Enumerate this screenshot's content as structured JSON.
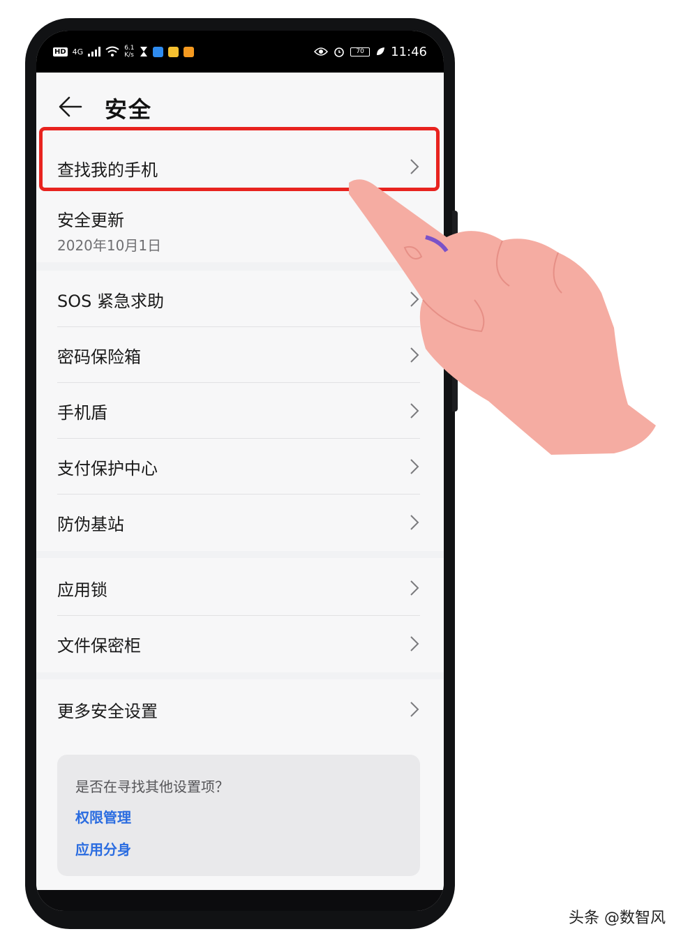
{
  "status_bar": {
    "hd": "HD",
    "network": "4G",
    "speed_value": "6.1",
    "speed_unit": "K/s",
    "battery": "70",
    "time": "11:46",
    "icons": [
      "signal-icon",
      "wifi-icon",
      "hourglass-icon",
      "app-notification-icon",
      "eye-icon",
      "alarm-icon",
      "battery-icon",
      "leaf-icon"
    ]
  },
  "header": {
    "title": "安全",
    "back_icon": "arrow-left-icon"
  },
  "groups": [
    {
      "items": [
        {
          "label": "查找我的手机",
          "highlighted": true
        },
        {
          "label": "安全更新",
          "sub": "2020年10月1日"
        }
      ]
    },
    {
      "items": [
        {
          "label": "SOS 紧急求助"
        },
        {
          "label": "密码保险箱"
        },
        {
          "label": "手机盾"
        },
        {
          "label": "支付保护中心"
        },
        {
          "label": "防伪基站"
        }
      ]
    },
    {
      "items": [
        {
          "label": "应用锁"
        },
        {
          "label": "文件保密柜"
        }
      ]
    },
    {
      "items": [
        {
          "label": "更多安全设置"
        }
      ]
    }
  ],
  "tip": {
    "question": "是否在寻找其他设置项？",
    "links": [
      "权限管理",
      "应用分身"
    ]
  },
  "highlight_color": "#e8231f",
  "link_color": "#2a6ce0",
  "watermark": "头条 @数智风"
}
